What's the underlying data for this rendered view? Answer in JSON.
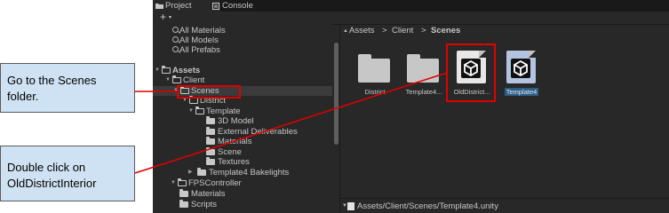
{
  "tabs": [
    {
      "label": "Project",
      "icon": "folder-icon"
    },
    {
      "label": "Console",
      "icon": "console-icon"
    }
  ],
  "toolbar": {
    "add_label": "+",
    "caret": "▾"
  },
  "tree": {
    "favorites": [
      "All Materials",
      "All Models",
      "All Prefabs"
    ],
    "assets": "Assets",
    "client": "Client",
    "scenes": "Scenes",
    "district": "District",
    "template": "Template",
    "model3d": "3D Model",
    "external": "External Deliverables",
    "materials": "Materials",
    "scene": "Scene",
    "textures": "Textures",
    "bakelights": "Template4 Bakelights",
    "fps": "FPSController",
    "fps_materials": "Materials",
    "fps_scripts": "Scripts"
  },
  "breadcrumb": {
    "assets": "Assets",
    "client": "Client",
    "scenes": "Scenes",
    "sep": ">"
  },
  "assets": [
    {
      "label": "District",
      "kind": "folder"
    },
    {
      "label": "Template4...",
      "kind": "folder"
    },
    {
      "label": "OldDistrict...",
      "kind": "scene"
    },
    {
      "label": "Template4",
      "kind": "scene"
    }
  ],
  "status": {
    "path": "Assets/Client/Scenes/Template4.unity"
  },
  "callouts": {
    "step1": "Go to the Scenes folder.",
    "step2": "Double click on OldDistrictInterior"
  },
  "colors": {
    "highlight": "#e00000",
    "callout_bg": "#cfe2f3",
    "panel_bg": "#282828",
    "selection": "#2c5d87"
  }
}
